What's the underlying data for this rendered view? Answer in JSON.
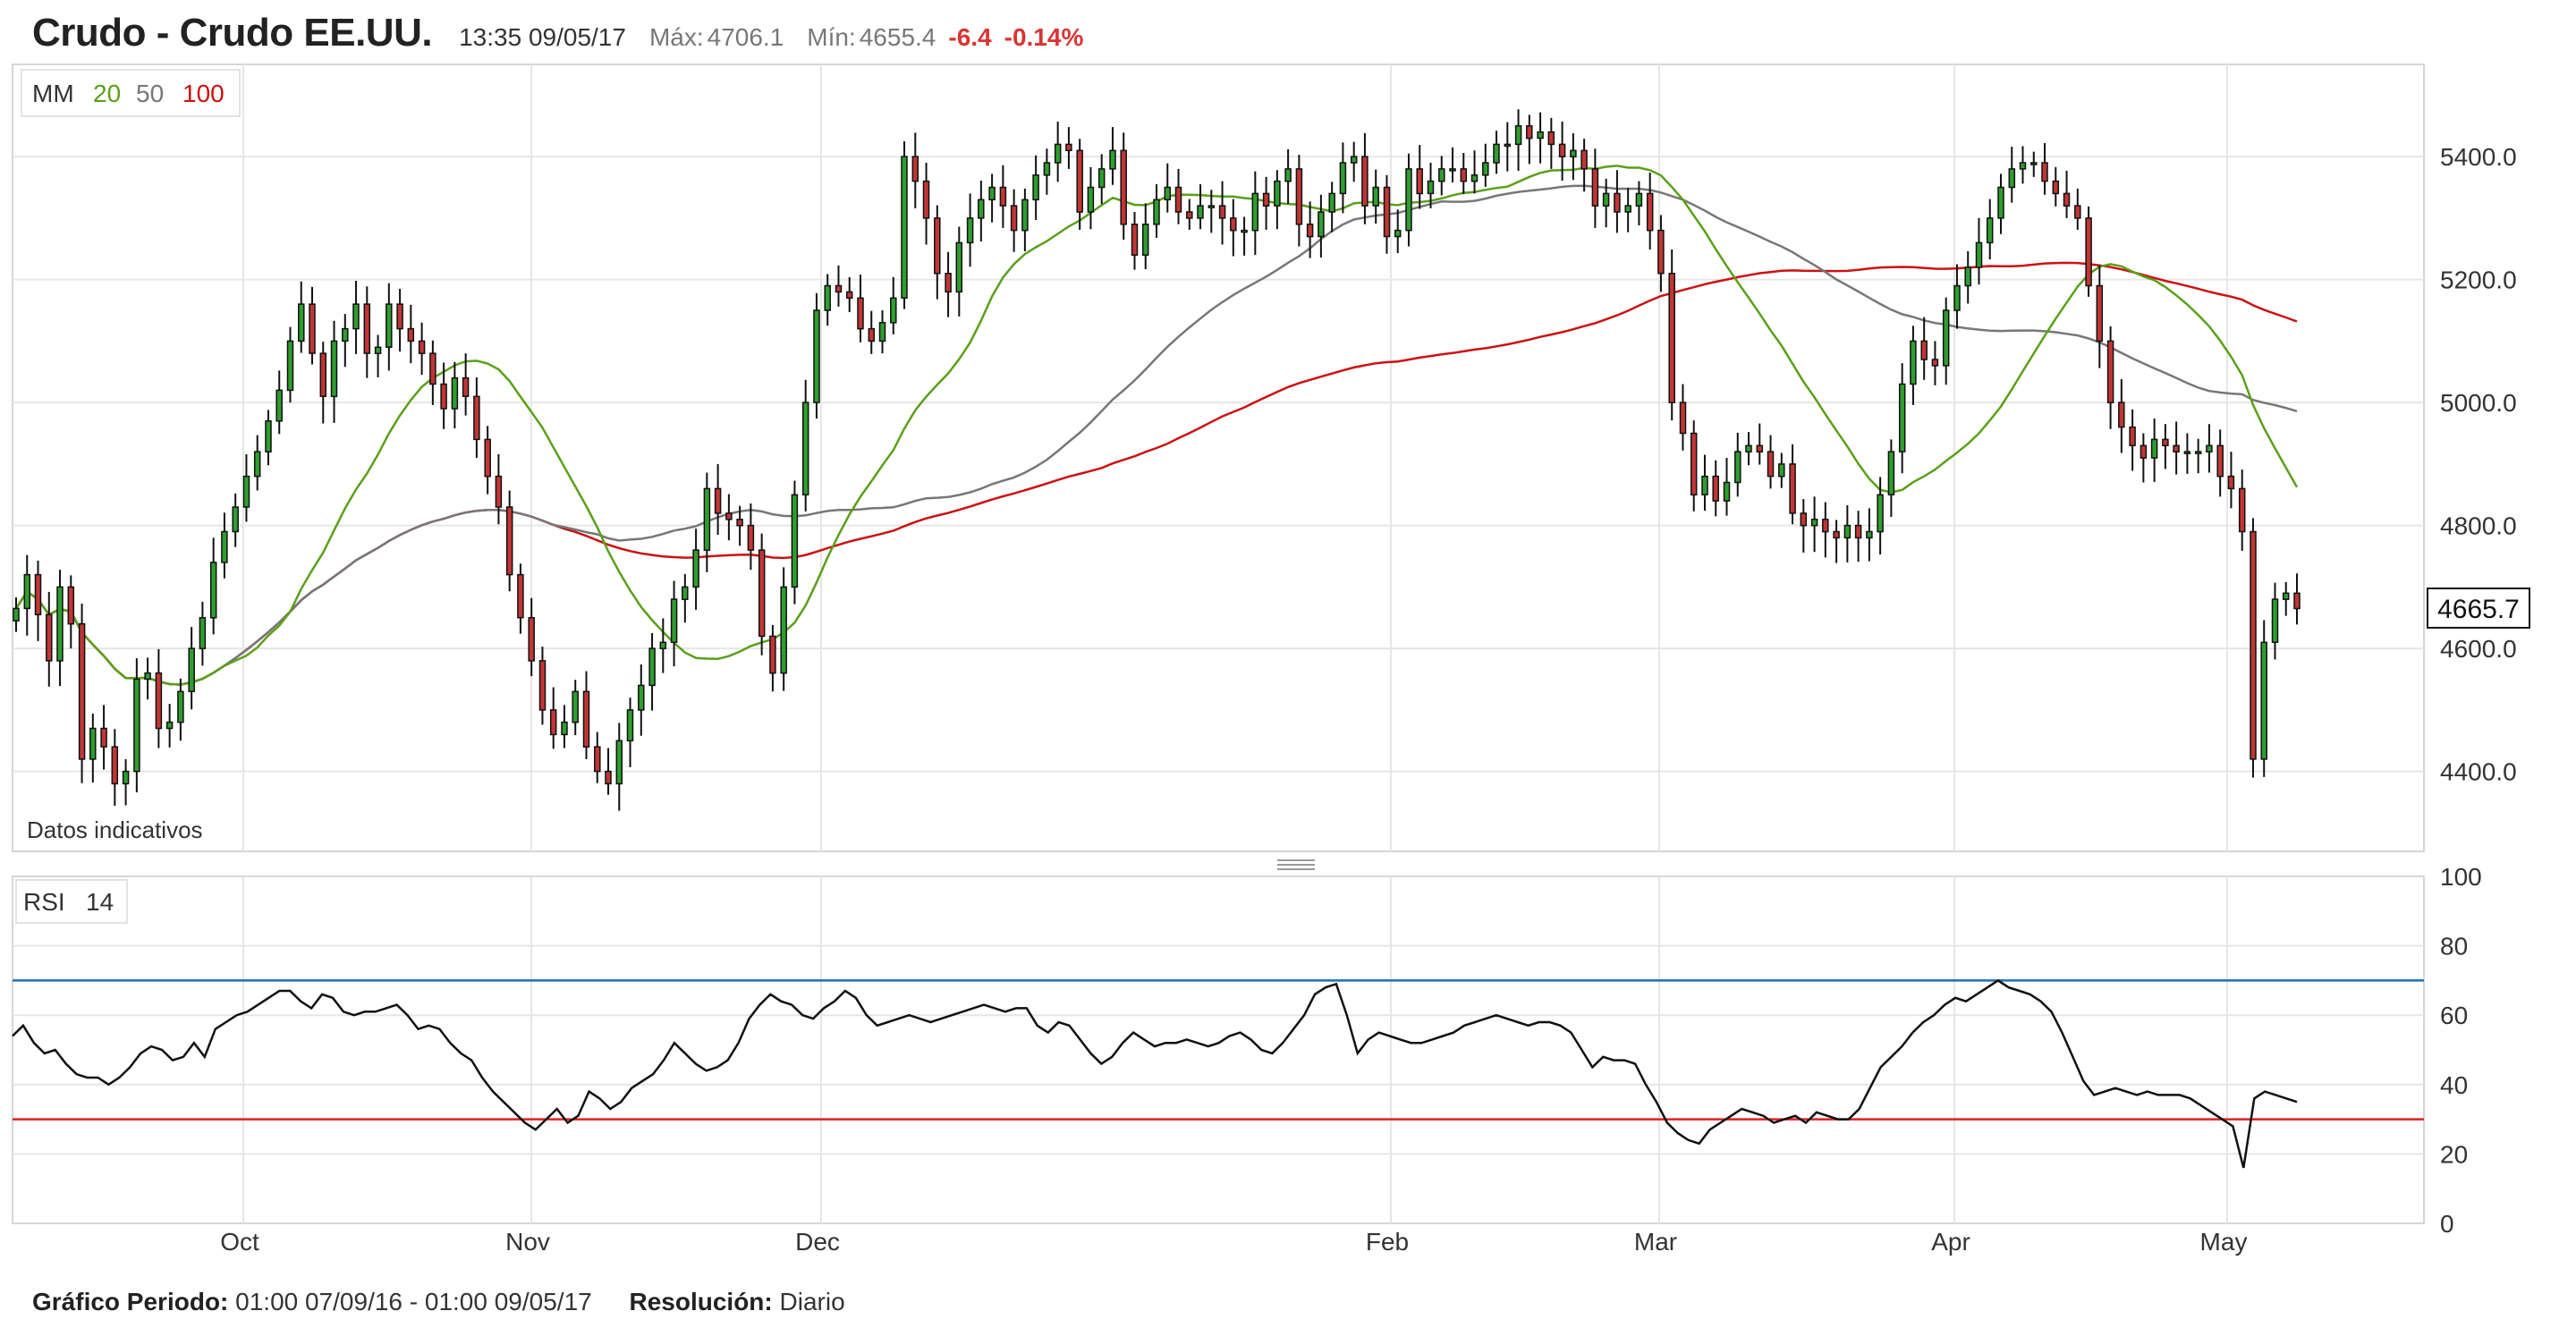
{
  "header": {
    "title": "Crudo - Crudo EE.UU.",
    "time": "13:35 09/05/17",
    "max_label": "Máx:",
    "max_value": "4706.1",
    "min_label": "Mín:",
    "min_value": "4655.4",
    "change": "-6.4",
    "change_pct": "-0.14%"
  },
  "legend": {
    "mm_label": "MM",
    "mm_periods": [
      "20",
      "50",
      "100"
    ],
    "note": "Datos indicativos",
    "rsi_label": "RSI",
    "rsi_period": "14"
  },
  "footer": {
    "period_label": "Gráfico Periodo:",
    "period_value": "01:00 07/09/16 - 01:00 09/05/17",
    "resolution_label": "Resolución:",
    "resolution_value": "Diario"
  },
  "colors": {
    "up": "#2e9e2e",
    "down": "#c23535",
    "mm20": "#5aa018",
    "mm50": "#777777",
    "mm100": "#cc1111",
    "rsi_upper": "#1f6fb5",
    "rsi_lower": "#e02020"
  },
  "chart_data": [
    {
      "type": "candlestick",
      "title": "Crudo - Crudo EE.UU.",
      "x_ticks": [
        "Oct",
        "Nov",
        "Dec",
        "Feb",
        "Mar",
        "Apr",
        "May"
      ],
      "ylim": [
        4270,
        5550
      ],
      "y_ticks": [
        "4400.0",
        "4600.0",
        "4800.0",
        "5000.0",
        "5200.0",
        "5400.0"
      ],
      "last_price": "4665.7",
      "grid": true,
      "closes": [
        4665,
        4720,
        4655,
        4580,
        4700,
        4640,
        4420,
        4470,
        4440,
        4380,
        4400,
        4550,
        4560,
        4470,
        4480,
        4530,
        4600,
        4650,
        4740,
        4790,
        4830,
        4880,
        4920,
        4970,
        5020,
        5100,
        5160,
        5080,
        5010,
        5100,
        5120,
        5160,
        5080,
        5090,
        5160,
        5120,
        5100,
        5080,
        5030,
        4990,
        5040,
        5010,
        4940,
        4880,
        4830,
        4720,
        4650,
        4580,
        4500,
        4460,
        4480,
        4530,
        4440,
        4400,
        4380,
        4450,
        4500,
        4540,
        4600,
        4610,
        4680,
        4700,
        4760,
        4860,
        4820,
        4810,
        4800,
        4760,
        4620,
        4560,
        4700,
        4850,
        5000,
        5150,
        5190,
        5180,
        5170,
        5120,
        5100,
        5130,
        5170,
        5400,
        5360,
        5300,
        5210,
        5180,
        5260,
        5300,
        5330,
        5350,
        5320,
        5280,
        5330,
        5370,
        5390,
        5420,
        5410,
        5310,
        5350,
        5380,
        5410,
        5290,
        5240,
        5290,
        5330,
        5350,
        5310,
        5300,
        5320,
        5320,
        5300,
        5280,
        5280,
        5340,
        5320,
        5360,
        5380,
        5290,
        5270,
        5310,
        5340,
        5390,
        5400,
        5320,
        5350,
        5270,
        5280,
        5380,
        5340,
        5360,
        5380,
        5380,
        5360,
        5370,
        5390,
        5420,
        5420,
        5450,
        5430,
        5440,
        5420,
        5400,
        5410,
        5380,
        5320,
        5340,
        5310,
        5320,
        5340,
        5280,
        5210,
        5000,
        4950,
        4850,
        4880,
        4840,
        4870,
        4920,
        4930,
        4920,
        4880,
        4900,
        4820,
        4800,
        4810,
        4790,
        4780,
        4800,
        4780,
        4790,
        4850,
        4920,
        5030,
        5100,
        5070,
        5060,
        5150,
        5190,
        5220,
        5260,
        5300,
        5350,
        5380,
        5390,
        5390,
        5360,
        5340,
        5320,
        5300,
        5190,
        5100,
        5000,
        4960,
        4930,
        4910,
        4940,
        4930,
        4920,
        4920,
        4920,
        4930,
        4880,
        4860,
        4790,
        4420,
        4610,
        4680,
        4690,
        4665
      ]
    },
    {
      "type": "line",
      "title": "RSI 14",
      "x_ticks": [
        "Oct",
        "Nov",
        "Dec",
        "Feb",
        "Mar",
        "Apr",
        "May"
      ],
      "ylim": [
        0,
        100
      ],
      "y_ticks": [
        "0",
        "20",
        "40",
        "60",
        "80",
        "100"
      ],
      "levels": [
        30,
        70
      ],
      "values": [
        54,
        57,
        52,
        49,
        50,
        46,
        43,
        42,
        42,
        40,
        42,
        45,
        49,
        51,
        50,
        47,
        48,
        52,
        48,
        56,
        58,
        60,
        61,
        63,
        65,
        67,
        67,
        64,
        62,
        66,
        65,
        61,
        60,
        61,
        61,
        62,
        63,
        60,
        56,
        57,
        56,
        52,
        49,
        47,
        42,
        38,
        35,
        32,
        29,
        27,
        30,
        33,
        29,
        31,
        38,
        36,
        33,
        35,
        39,
        41,
        43,
        47,
        52,
        49,
        46,
        44,
        45,
        47,
        52,
        59,
        63,
        66,
        64,
        63,
        60,
        59,
        62,
        64,
        67,
        65,
        60,
        57,
        58,
        59,
        60,
        59,
        58,
        59,
        60,
        61,
        62,
        63,
        62,
        61,
        62,
        62,
        57,
        55,
        58,
        57,
        53,
        49,
        46,
        48,
        52,
        55,
        53,
        51,
        52,
        52,
        53,
        52,
        51,
        52,
        54,
        55,
        53,
        50,
        49,
        52,
        56,
        60,
        66,
        68,
        69,
        60,
        49,
        53,
        55,
        54,
        53,
        52,
        52,
        53,
        54,
        55,
        57,
        58,
        59,
        60,
        59,
        58,
        57,
        58,
        58,
        57,
        55,
        50,
        45,
        48,
        47,
        47,
        46,
        40,
        35,
        29,
        26,
        24,
        23,
        27,
        29,
        31,
        33,
        32,
        31,
        29,
        30,
        31,
        29,
        32,
        31,
        30,
        30,
        33,
        39,
        45,
        48,
        51,
        55,
        58,
        60,
        63,
        65,
        64,
        66,
        68,
        70,
        68,
        67,
        66,
        64,
        61,
        55,
        48,
        41,
        37,
        38,
        39,
        38,
        37,
        38,
        37,
        37,
        37,
        36,
        34,
        32,
        30,
        28,
        16,
        36,
        38,
        37,
        36,
        35
      ]
    }
  ]
}
